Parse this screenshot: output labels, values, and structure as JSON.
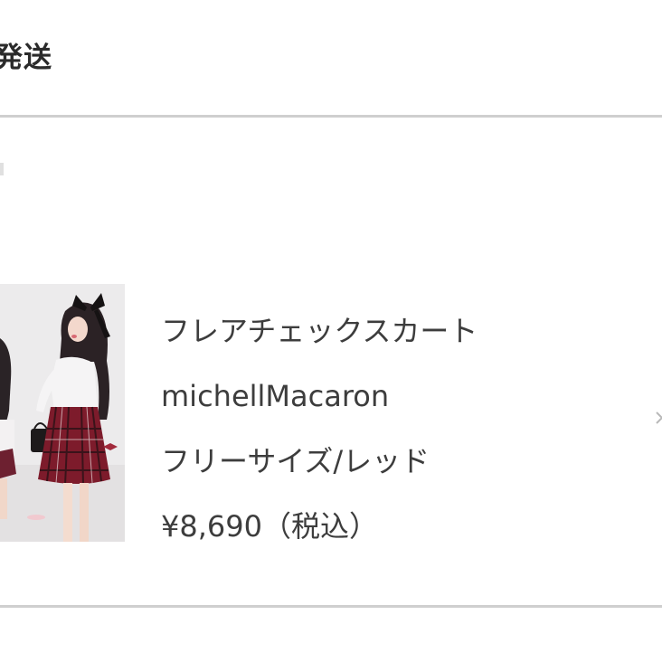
{
  "header": {
    "title": "発送"
  },
  "product": {
    "image_icon": "product-photo-model-plaid-skirt",
    "name": "フレアチェックスカート",
    "brand": "michellMacaron",
    "variant": "フリーサイズ/レッド",
    "price": "¥8,690（税込）"
  },
  "colors": {
    "divider": "#cfcfcf",
    "text": "#3d3d3d",
    "skirt_red": "#7d1b2b"
  }
}
